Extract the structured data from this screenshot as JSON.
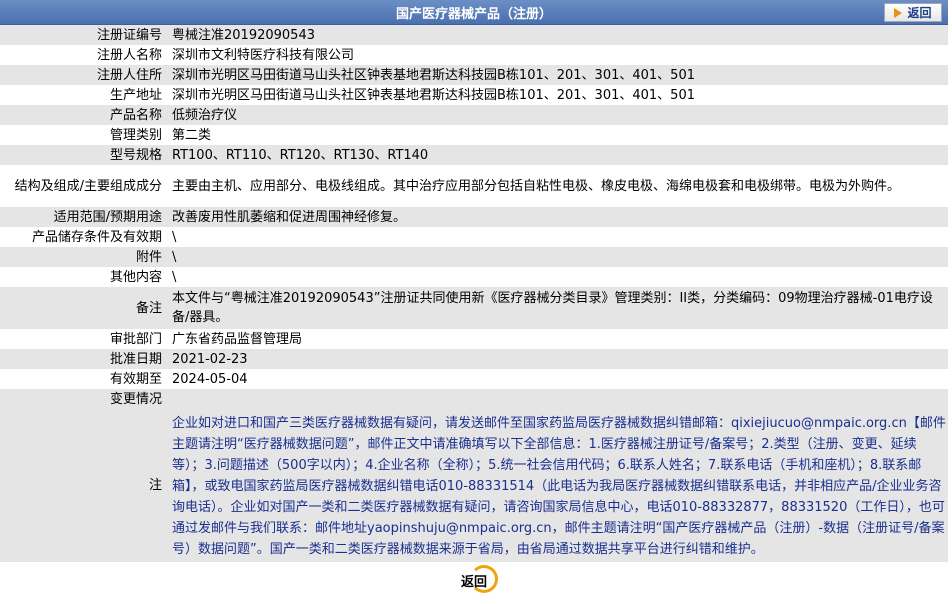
{
  "header": {
    "title": "国产医疗器械产品（注册）",
    "back_label": "返回"
  },
  "rows": [
    {
      "label": "注册证编号",
      "value": "粤械注准20192090543"
    },
    {
      "label": "注册人名称",
      "value": "深圳市文利特医疗科技有限公司"
    },
    {
      "label": "注册人住所",
      "value": "深圳市光明区马田街道马山头社区钟表基地君斯达科技园B栋101、201、301、401、501"
    },
    {
      "label": "生产地址",
      "value": "深圳市光明区马田街道马山头社区钟表基地君斯达科技园B栋101、201、301、401、501"
    },
    {
      "label": "产品名称",
      "value": "低频治疗仪"
    },
    {
      "label": "管理类别",
      "value": "第二类"
    },
    {
      "label": "型号规格",
      "value": "RT100、RT110、RT120、RT130、RT140"
    },
    {
      "label": "结构及组成/主要组成成分",
      "value": "主要由主机、应用部分、电极线组成。其中治疗应用部分包括自粘性电极、橡皮电极、海绵电极套和电极绑带。电极为外购件。"
    },
    {
      "label": "适用范围/预期用途",
      "value": "改善废用性肌萎缩和促进周围神经修复。"
    },
    {
      "label": "产品储存条件及有效期",
      "value": "\\"
    },
    {
      "label": "附件",
      "value": "\\"
    },
    {
      "label": "其他内容",
      "value": "\\"
    },
    {
      "label": "备注",
      "value": "本文件与“粤械注准20192090543”注册证共同使用新《医疗器械分类目录》管理类别：II类，分类编码：09物理治疗器械-01电疗设备/器具。"
    },
    {
      "label": "审批部门",
      "value": "广东省药品监督管理局"
    },
    {
      "label": "批准日期",
      "value": "2021-02-23"
    },
    {
      "label": "有效期至",
      "value": "2024-05-04"
    },
    {
      "label": "变更情况",
      "value": ""
    }
  ],
  "note": {
    "label": "注",
    "text": "企业如对进口和国产三类医疗器械数据有疑问，请发送邮件至国家药监局医疗器械数据纠错邮箱：qixiejiucuo@nmpaic.org.cn【邮件主题请注明“医疗器械数据问题”，邮件正文中请准确填写以下全部信息：1.医疗器械注册证号/备案号；2.类型（注册、变更、延续等）；3.问题描述（500字以内）；4.企业名称（全称）；5.统一社会信用代码；6.联系人姓名；7.联系电话（手机和座机）；8.联系邮箱】，或致电国家药监局医疗器械数据纠错电话010-88331514（此电话为我局医疗器械数据纠错联系电话，并非相应产品/企业业务咨询电话）。企业如对国产一类和二类医疗器械数据有疑问，请咨询国家局信息中心，电话010-88332877，88331520（工作日），也可通过发邮件与我们联系：邮件地址yaopinshuju@nmpaic.org.cn，邮件主题请注明“国产医疗器械产品（注册）-数据（注册证号/备案号）数据问题”。国产一类和二类医疗器械数据来源于省局，由省局通过数据共享平台进行纠错和维护。"
  },
  "footer": {
    "back_label": "返回"
  }
}
